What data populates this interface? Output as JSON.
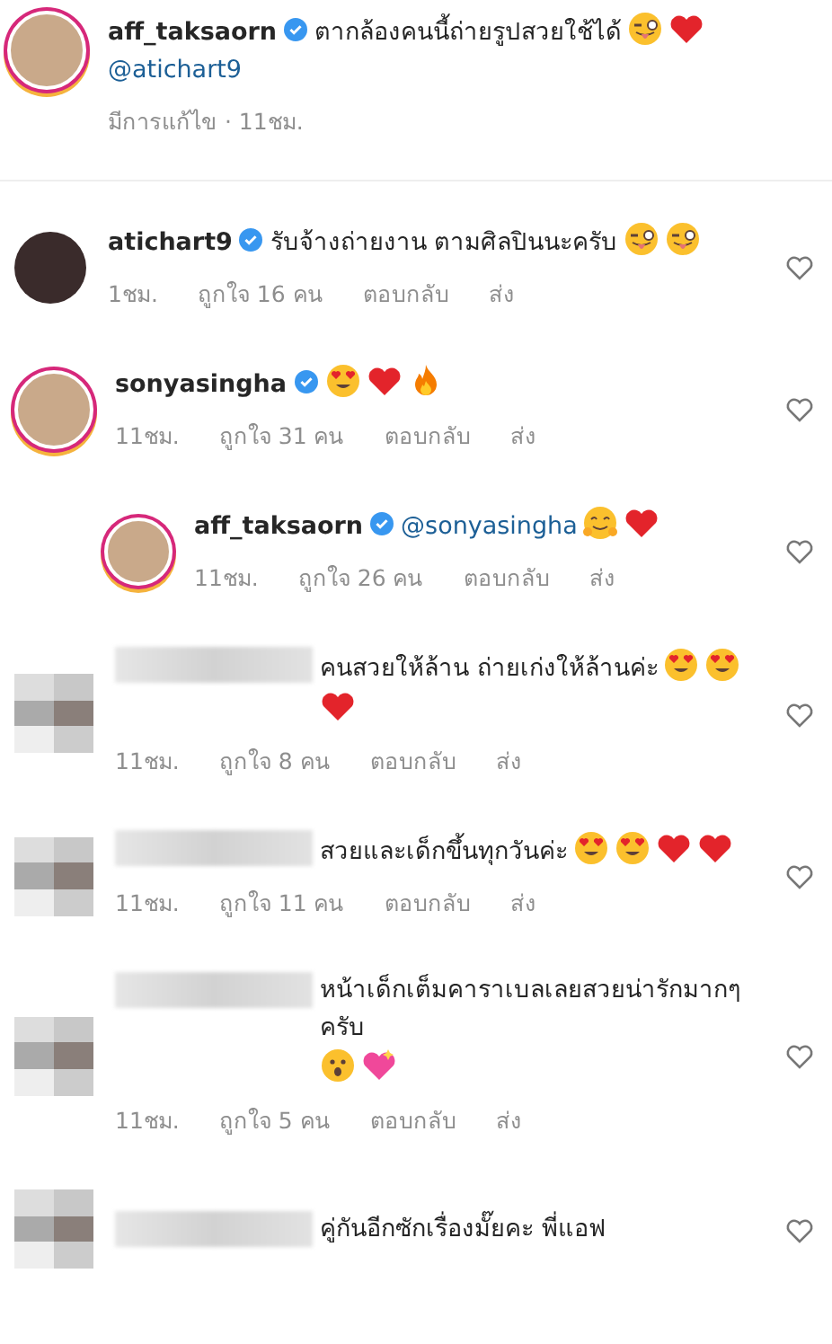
{
  "caption": {
    "username": "aff_taksaorn",
    "verified": true,
    "text": "ตากล้องคนนี้ถ่ายรูปสวยใช้ได้",
    "emojis": [
      {
        "kind": "wink"
      },
      {
        "kind": "heart"
      }
    ],
    "mention": "@atichart9",
    "edited": "มีการแก้ไข · 11ชม."
  },
  "comments": [
    {
      "kind": "plain",
      "username": "atichart9",
      "verified": true,
      "reply": false,
      "text": "รับจ้างถ่ายงาน ตามศิลปินนะครับ",
      "emojis": [
        {
          "kind": "wink"
        },
        {
          "kind": "wink"
        }
      ],
      "time": "1ชม.",
      "likes": "ถูกใจ 16 คน",
      "reply_label": "ตอบกลับ",
      "send_label": "ส่ง"
    },
    {
      "kind": "story",
      "username": "sonyasingha",
      "verified": true,
      "reply": false,
      "emojis": [
        {
          "kind": "hearteyes"
        },
        {
          "kind": "heart"
        },
        {
          "kind": "fire"
        }
      ],
      "time": "11ชม.",
      "likes": "ถูกใจ 31 คน",
      "reply_label": "ตอบกลับ",
      "send_label": "ส่ง"
    },
    {
      "kind": "story",
      "username": "aff_taksaorn",
      "verified": true,
      "reply": true,
      "mention": "@sonyasingha",
      "emojis": [
        {
          "kind": "hug"
        },
        {
          "kind": "heart"
        }
      ],
      "time": "11ชม.",
      "likes": "ถูกใจ 26 คน",
      "reply_label": "ตอบกลับ",
      "send_label": "ส่ง"
    },
    {
      "kind": "pixelated",
      "verified": false,
      "reply": false,
      "text": "คนสวยให้ล้าน ถ่ายเก่งให้ล้านค่ะ",
      "emojis": [
        {
          "kind": "hearteyes"
        },
        {
          "kind": "hearteyes"
        },
        {
          "kind": "heart"
        }
      ],
      "time": "11ชม.",
      "likes": "ถูกใจ 8 คน",
      "reply_label": "ตอบกลับ",
      "send_label": "ส่ง"
    },
    {
      "kind": "pixelated",
      "verified": false,
      "reply": false,
      "text": "สวยและเด็กขึ้นทุกวันค่ะ",
      "emojis": [
        {
          "kind": "hearteyes"
        },
        {
          "kind": "hearteyes"
        },
        {
          "kind": "heart"
        },
        {
          "kind": "heart"
        }
      ],
      "time": "11ชม.",
      "likes": "ถูกใจ 11 คน",
      "reply_label": "ตอบกลับ",
      "send_label": "ส่ง"
    },
    {
      "kind": "pixelated",
      "verified": false,
      "reply": false,
      "text": "หน้าเด็กเต็มคาราเบลเลยสวยน่ารักมากๆครับ",
      "emojis": [
        {
          "kind": "surprised"
        },
        {
          "kind": "sparkleheart"
        }
      ],
      "time": "11ชม.",
      "likes": "ถูกใจ 5 คน",
      "reply_label": "ตอบกลับ",
      "send_label": "ส่ง"
    },
    {
      "kind": "pixelated",
      "verified": false,
      "reply": false,
      "text": "คู่กันอีกซักเรื่องมั๊ยคะ พี่แอฟ"
    }
  ]
}
